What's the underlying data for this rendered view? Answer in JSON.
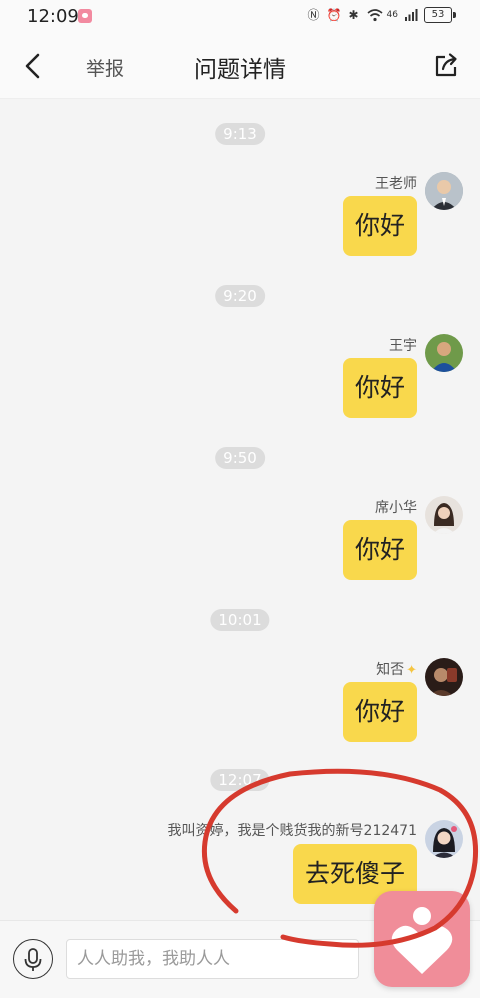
{
  "status": {
    "time": "12:09",
    "network": "46",
    "battery": "53"
  },
  "header": {
    "back_icon": "chevron-left-icon",
    "report_label": "举报",
    "title": "问题详情",
    "share_icon": "share-icon"
  },
  "messages": [
    {
      "time": "9:13",
      "sender": "王老师",
      "text": "你好"
    },
    {
      "time": "9:20",
      "sender": "王宇",
      "text": "你好"
    },
    {
      "time": "9:50",
      "sender": "席小华",
      "text": "你好"
    },
    {
      "time": "10:01",
      "sender": "知否",
      "text": "你好"
    },
    {
      "time": "12:07",
      "sender": "我叫资婷，我是个贱货我的新号212471",
      "text": "去死傻子"
    }
  ],
  "composer": {
    "placeholder": "人人助我，我助人人",
    "mic_icon": "microphone-icon"
  },
  "floating": {
    "icon": "heart-person-icon",
    "color": "#f08d99"
  },
  "colors": {
    "bubble": "#f9d84c",
    "annotation": "#d63a2e"
  }
}
